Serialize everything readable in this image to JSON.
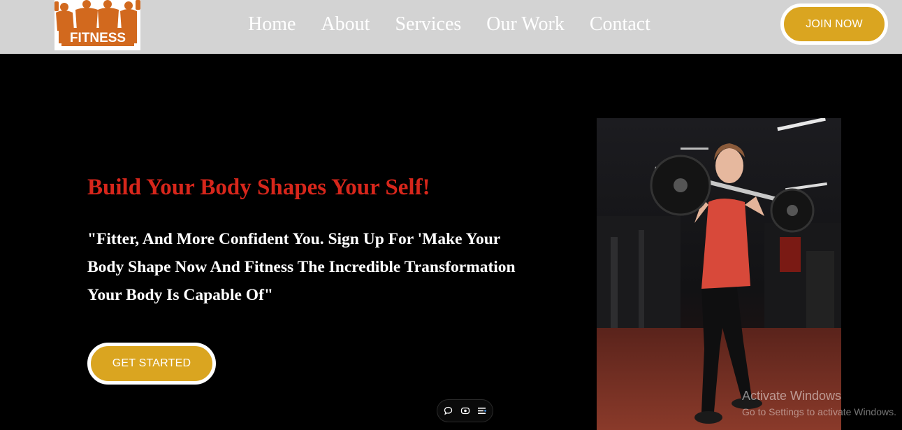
{
  "brand": {
    "logo_text": "FITNESS",
    "logo_color": "#d2691e"
  },
  "nav": {
    "items": [
      {
        "label": "Home"
      },
      {
        "label": "About"
      },
      {
        "label": "Services"
      },
      {
        "label": "Our Work"
      },
      {
        "label": "Contact"
      }
    ],
    "cta_label": "JOIN NOW"
  },
  "hero": {
    "title": "Build Your Body Shapes Your Self!",
    "text": "\"Fitter, And More Confident You. Sign Up For 'Make Your Body Shape Now And Fitness The Incredible Transformation Your Body Is Capable Of\"",
    "cta_label": "GET STARTED",
    "image": "woman-lifting-barbell-photo"
  },
  "widget": {
    "icons": [
      "comment-icon",
      "eye-icon",
      "menu-icon"
    ]
  },
  "watermark": {
    "title": "Activate Windows",
    "subtitle": "Go to Settings to activate Windows."
  },
  "colors": {
    "header_bg": "#d3d3d3",
    "accent": "#daa520",
    "title_red": "#d7261b",
    "background": "#000000"
  }
}
